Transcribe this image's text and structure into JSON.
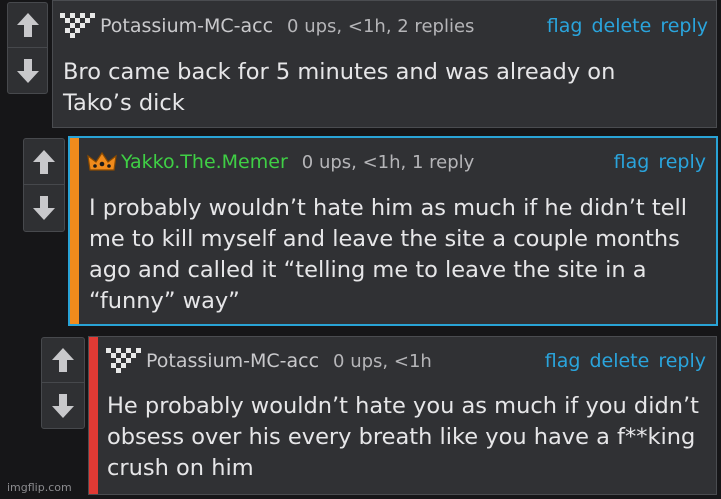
{
  "colors": {
    "background": "#161618",
    "panel": "#303134",
    "link": "#2aa4dc",
    "op_stripe": "#f08b1c",
    "reply_stripe": "#e03a34",
    "highlight_border": "#29a3d6",
    "mod_name": "#3fcf45"
  },
  "comments": [
    {
      "username": "Potassium-MC-acc",
      "avatar_icon": "pixel-avatar-icon",
      "stats": "0 ups, <1h, 2 replies",
      "actions": {
        "flag": "flag",
        "delete": "delete",
        "reply": "reply"
      },
      "text": "Bro came back for 5 minutes and was already on\nTako’s dick"
    },
    {
      "username": "Yakko.The.Memer",
      "avatar_icon": "crown-icon",
      "stats": "0 ups, <1h, 1 reply",
      "actions": {
        "flag": "flag",
        "reply": "reply"
      },
      "text": "I probably wouldn’t hate him as much if he didn’t tell\nme to kill myself and leave the site a couple months\nago and called it “telling me to leave the site in a\n“funny” way”"
    },
    {
      "username": "Potassium-MC-acc",
      "avatar_icon": "pixel-avatar-icon",
      "stats": "0 ups, <1h",
      "actions": {
        "flag": "flag",
        "delete": "delete",
        "reply": "reply"
      },
      "text": "He probably wouldn’t hate you as much if you didn’t\nobsess over his every breath like you have a f**king\ncrush on him"
    }
  ],
  "watermark": "imgflip.com"
}
